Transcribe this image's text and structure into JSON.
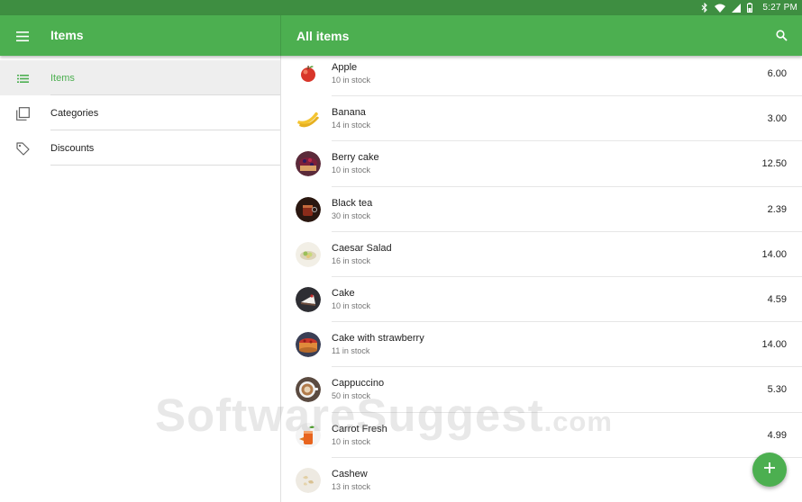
{
  "status_bar": {
    "time": "5:27 PM",
    "icons": [
      "bluetooth-icon",
      "wifi-icon",
      "signal-icon",
      "battery-icon"
    ]
  },
  "app_bar": {
    "title": "Items",
    "content_title": "All items",
    "menu_icon": "menu-icon",
    "search_icon": "search-icon"
  },
  "colors": {
    "primary": "#4caf50",
    "status_bar": "#3e8e41",
    "active_text": "#4caf50"
  },
  "sidebar": {
    "items": [
      {
        "label": "Items",
        "icon": "list-icon",
        "active": true
      },
      {
        "label": "Categories",
        "icon": "categories-icon",
        "active": false
      },
      {
        "label": "Discounts",
        "icon": "tag-icon",
        "active": false
      }
    ]
  },
  "items": [
    {
      "name": "Apple",
      "stock": "10 in stock",
      "price": "6.00",
      "icon": "apple-icon"
    },
    {
      "name": "Banana",
      "stock": "14 in stock",
      "price": "3.00",
      "icon": "banana-icon"
    },
    {
      "name": "Berry cake",
      "stock": "10 in stock",
      "price": "12.50",
      "icon": "berry-cake-icon"
    },
    {
      "name": "Black tea",
      "stock": "30 in stock",
      "price": "2.39",
      "icon": "black-tea-icon"
    },
    {
      "name": "Caesar Salad",
      "stock": "16 in stock",
      "price": "14.00",
      "icon": "salad-icon"
    },
    {
      "name": "Cake",
      "stock": "10 in stock",
      "price": "4.59",
      "icon": "cake-icon"
    },
    {
      "name": "Cake with strawberry",
      "stock": "11 in stock",
      "price": "14.00",
      "icon": "strawberry-cake-icon"
    },
    {
      "name": "Cappuccino",
      "stock": "50 in stock",
      "price": "5.30",
      "icon": "cappuccino-icon"
    },
    {
      "name": "Carrot Fresh",
      "stock": "10 in stock",
      "price": "4.99",
      "icon": "carrot-juice-icon"
    },
    {
      "name": "Cashew",
      "stock": "13 in stock",
      "price": "",
      "icon": "cashew-icon"
    }
  ],
  "fab": {
    "icon": "plus-icon"
  },
  "watermark": {
    "text": "SoftwareSuggest",
    "suffix": ".com"
  }
}
